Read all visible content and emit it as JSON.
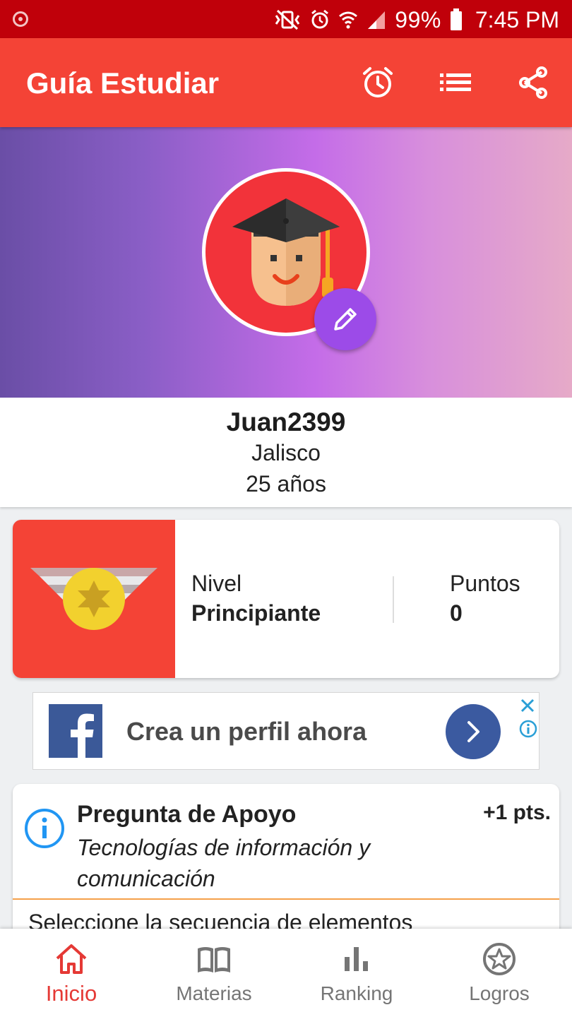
{
  "status_bar": {
    "battery": "99%",
    "time": "7:45 PM"
  },
  "app_bar": {
    "title": "Guía Estudiar"
  },
  "profile": {
    "username": "Juan2399",
    "state": "Jalisco",
    "age": "25 años"
  },
  "level_card": {
    "level_label": "Nivel",
    "level_value": "Principiante",
    "points_label": "Puntos",
    "points_value": "0"
  },
  "ad": {
    "text": "Crea un perfil ahora"
  },
  "question": {
    "title": "Pregunta de Apoyo",
    "points": "+1 pts.",
    "subject": "Tecnologías de información y comunicación",
    "text": "Seleccione la secuencia de elementos"
  },
  "bottom_nav": {
    "items": [
      {
        "label": "Inicio",
        "icon": "home-icon",
        "active": true
      },
      {
        "label": "Materias",
        "icon": "book-icon",
        "active": false
      },
      {
        "label": "Ranking",
        "icon": "bar-chart-icon",
        "active": false
      },
      {
        "label": "Logros",
        "icon": "star-badge-icon",
        "active": false
      }
    ]
  },
  "colors": {
    "status_bar": "#c0000a",
    "primary": "#f44336",
    "accent": "#9c4be8",
    "nav_active": "#e53935"
  }
}
